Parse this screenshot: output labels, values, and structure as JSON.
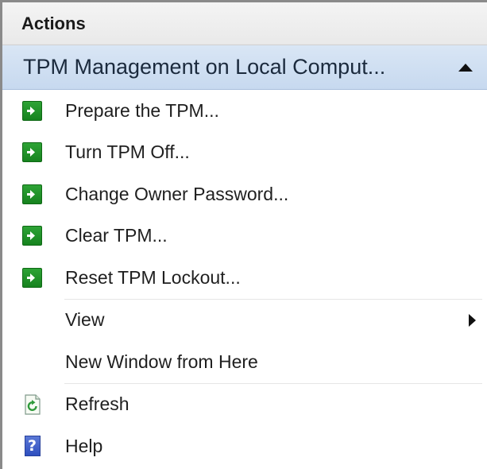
{
  "panel": {
    "title": "Actions"
  },
  "section": {
    "title": "TPM Management on Local Comput..."
  },
  "items": [
    {
      "label": "Prepare the TPM...",
      "icon": "green-go-arrow-icon"
    },
    {
      "label": "Turn TPM Off...",
      "icon": "green-go-arrow-icon"
    },
    {
      "label": "Change Owner Password...",
      "icon": "green-go-arrow-icon"
    },
    {
      "label": "Clear TPM...",
      "icon": "green-go-arrow-icon"
    },
    {
      "label": "Reset TPM Lockout...",
      "icon": "green-go-arrow-icon"
    },
    {
      "label": "View",
      "icon": "none",
      "submenu": true
    },
    {
      "label": "New Window from Here",
      "icon": "none"
    },
    {
      "label": "Refresh",
      "icon": "refresh-icon"
    },
    {
      "label": "Help",
      "icon": "help-icon"
    }
  ],
  "colors": {
    "section_bg": "#c7d9ef",
    "action_icon": "#17831f",
    "help_icon": "#2e4fbf"
  }
}
